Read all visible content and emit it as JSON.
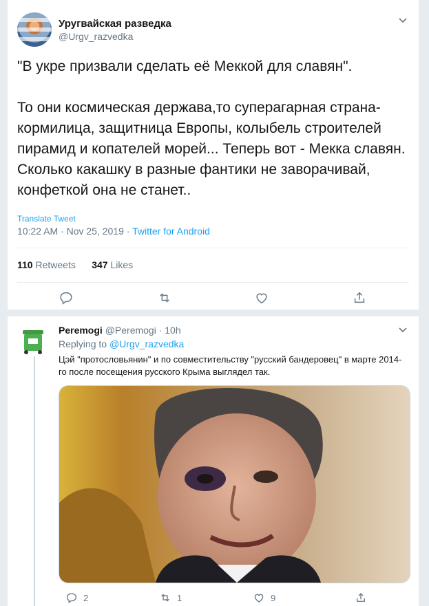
{
  "main_tweet": {
    "author_name": "Уругвайская разведка",
    "author_handle": "@Urgv_razvedka",
    "text": "\"В укре призвали сделать её Меккой для славян\".\n\nТо они космическая держава,то суперагарная страна-кормилица, защитница Европы, колыбель строителей пирамид и копателей морей... Теперь вот - Мекка славян. Сколько какашку в разные фантики не заворачивай, конфеткой она не станет..",
    "translate_label": "Translate Tweet",
    "timestamp": "10:22 AM · Nov 25, 2019 · ",
    "source": "Twitter for Android",
    "retweets_count": "110",
    "retweets_label": "Retweets",
    "likes_count": "347",
    "likes_label": "Likes"
  },
  "reply": {
    "author_name": "Peremogi",
    "author_handle": "@Peremogi · 10h",
    "replying_prefix": "Replying to ",
    "replying_to": "@Urgv_razvedka",
    "text": "Цэй \"протословьянин\" и по совместительству \"русский бандеровец\" в марте 2014-го после посещения русского Крыма выглядел так.",
    "reply_count": "2",
    "retweet_count": "1",
    "like_count": "9"
  },
  "colors": {
    "accent": "#1da1f2",
    "secondary_text": "#657786",
    "divider": "#e6ecf0"
  },
  "icons": [
    "chevron-down-icon",
    "reply-icon",
    "retweet-icon",
    "like-icon",
    "share-icon"
  ]
}
